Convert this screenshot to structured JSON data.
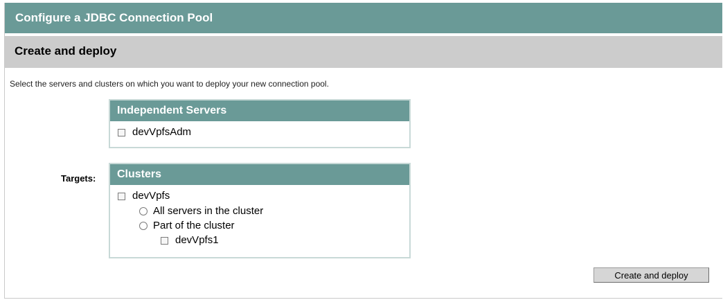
{
  "window": {
    "title": "Configure a JDBC Connection Pool"
  },
  "section": {
    "title": "Create and deploy"
  },
  "instructions": "Select the servers and clusters on which you want to deploy your new connection pool.",
  "targets_label": "Targets:",
  "independent_servers": {
    "header": "Independent Servers",
    "items": [
      {
        "label": "devVpfsAdm",
        "checked": false
      }
    ]
  },
  "clusters": {
    "header": "Clusters",
    "items": [
      {
        "label": "devVpfs",
        "checked": false,
        "options": [
          {
            "label": "All servers in the cluster",
            "selected": false
          },
          {
            "label": "Part of the cluster",
            "selected": false
          }
        ],
        "servers": [
          {
            "label": "devVpfs1",
            "checked": false
          }
        ]
      }
    ]
  },
  "actions": {
    "deploy_label": "Create and deploy"
  },
  "colors": {
    "title_bar": "#6a9a97",
    "section_bar": "#cccccc",
    "panel_header": "#6a9a97",
    "panel_border": "#c8d9d7"
  }
}
